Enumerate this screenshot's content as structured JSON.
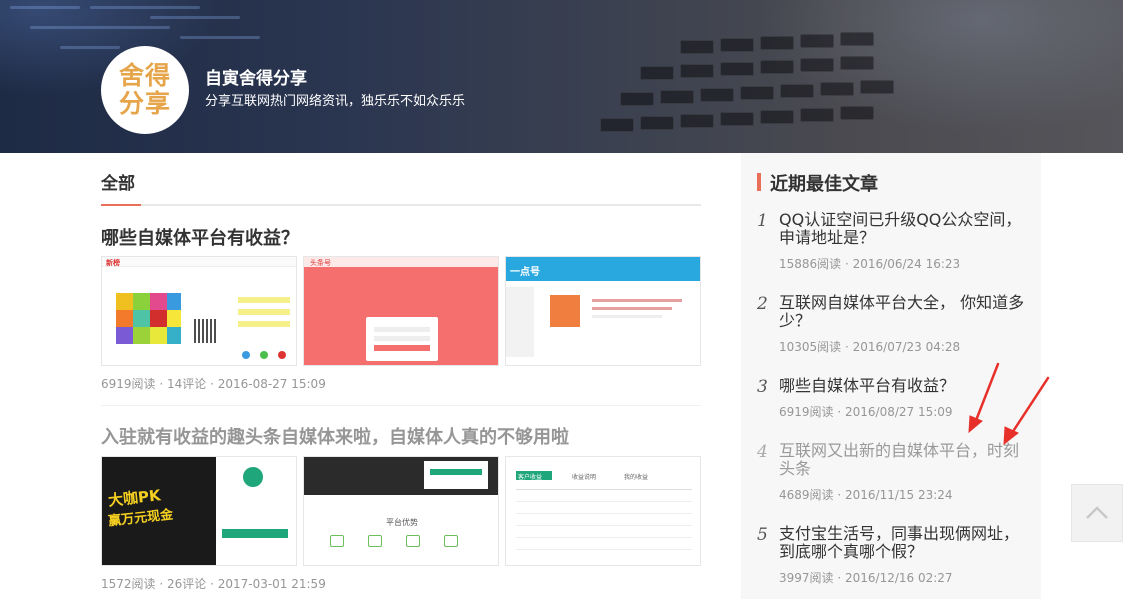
{
  "site": {
    "logo_text": "舍得分享",
    "title": "自寅舍得分享",
    "description": "分享互联网热门网络资讯，独乐乐不如众乐乐"
  },
  "section": {
    "title": "全部"
  },
  "articles": [
    {
      "title": "哪些自媒体平台有收益？",
      "meta": "6919阅读 · 14评论 · 2016-08-27 15:09",
      "thumb1_text": "新榜",
      "thumb2_text": "头条号",
      "thumb3_text": "一点号"
    },
    {
      "title": "入驻就有收益的趣头条自媒体来啦，自媒体人真的不够用啦",
      "meta": "1572阅读 · 26评论 · 2017-03-01 21:59",
      "thumb1_line1": "大咖PK",
      "thumb1_line2": "赢万元现金",
      "thumb2_text": "平台优势",
      "thumb3_tab1": "客户收益",
      "thumb3_tab2": "收益说明",
      "thumb3_tab3": "我的收益"
    }
  ],
  "sidebar": {
    "title": "近期最佳文章",
    "items": [
      {
        "rank": "1",
        "title": "QQ认证空间已升级QQ公众空间，申请地址是？",
        "meta": "15886阅读 · 2016/06/24 16:23"
      },
      {
        "rank": "2",
        "title": "互联网自媒体平台大全， 你知道多少？",
        "meta": "10305阅读 · 2016/07/23 04:28"
      },
      {
        "rank": "3",
        "title": "哪些自媒体平台有收益？",
        "meta": "6919阅读 · 2016/08/27 15:09"
      },
      {
        "rank": "4",
        "title": "互联网又出新的自媒体平台，时刻头条",
        "meta": "4689阅读 · 2016/11/15 23:24"
      },
      {
        "rank": "5",
        "title": "支付宝生活号，同事出现俩网址，到底哪个真哪个假？",
        "meta": "3997阅读 · 2016/12/16 02:27"
      }
    ]
  },
  "colors": {
    "accent": "#ea6f5a",
    "annotation_arrow": "#e8302a",
    "logo_text": "#e6a54a"
  },
  "icons": {
    "back_to_top": "chevron-up-icon"
  }
}
